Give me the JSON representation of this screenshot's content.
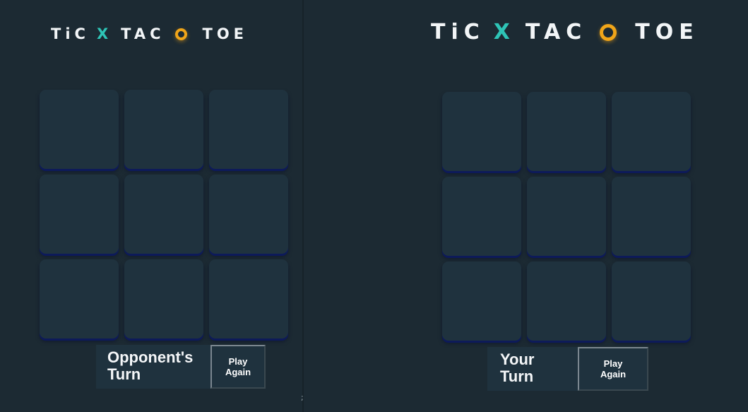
{
  "title": {
    "word1": "TiC",
    "x_symbol": "X",
    "word2": "TAC",
    "o_symbol": "O",
    "word3": "TOE"
  },
  "colors": {
    "background": "#1c2a33",
    "cell": "#1f323e",
    "x_accent": "#2ec4b6",
    "o_accent": "#f0a519",
    "text": "#f2f5f7"
  },
  "left_game": {
    "board": [
      "",
      "",
      "",
      "",
      "",
      "",
      "",
      "",
      ""
    ],
    "status": "Opponent's\nTurn",
    "play_again_label": "Play\nAgain"
  },
  "right_game": {
    "board": [
      "",
      "",
      "",
      "",
      "",
      "",
      "",
      "",
      ""
    ],
    "status": "Your\nTurn",
    "play_again_label": "Play\nAgain"
  },
  "divider_mark": ";"
}
